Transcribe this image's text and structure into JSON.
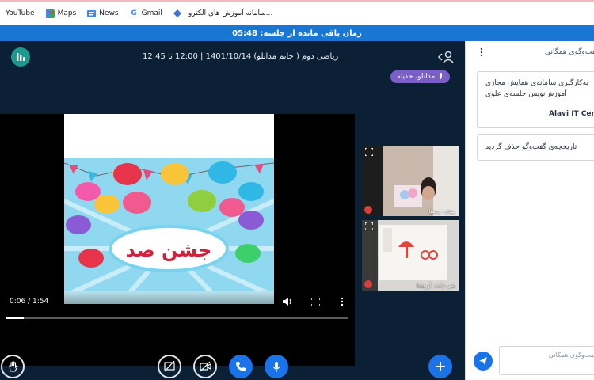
{
  "bookmarks": [
    {
      "label": "YouTube",
      "icon": "youtube-icon"
    },
    {
      "label": "Maps",
      "icon": "maps-icon"
    },
    {
      "label": "News",
      "icon": "news-icon"
    },
    {
      "label": "Gmail",
      "icon": "google-icon"
    },
    {
      "label": "سامانه آموزش های الکترو...",
      "icon": "bookmark-diamond-icon"
    }
  ],
  "timer": {
    "label": "زمان باقی مانده از جلسه: 05:48"
  },
  "meeting": {
    "title": "ریاضی دوم ( خانم مدانلو) 1401/10/14 | 12:00 تا 12:45",
    "presenter": "مدانلو، حدیثه"
  },
  "video": {
    "time": "0:06 / 1:54",
    "progress": 0.05,
    "poster_text": "جشن صد"
  },
  "webcams": [
    {
      "name": "بیدی، ترسنا"
    },
    {
      "name": "نقی زاده، آرونشا"
    }
  ],
  "chat": {
    "title": "گفت‌وگوی همگانی",
    "card1_line1": "به‌کارگیری سامانه‌ی همایش مجازی",
    "card1_line2": "آموزش‌نویس جلسه‌ی علوی",
    "card1_line3": "Alavi IT Center",
    "card2_text": "تاریخچه‌ی گفت‌وگو حذف گردید",
    "input_placeholder": "فرستادن پیام به گفت‌وگوی همگانی"
  },
  "colors": {
    "accent_blue": "#1976d2",
    "main_bg": "#0c2035",
    "presenter_purple": "#7b5fc6",
    "stats_teal": "#1b9a8d"
  }
}
